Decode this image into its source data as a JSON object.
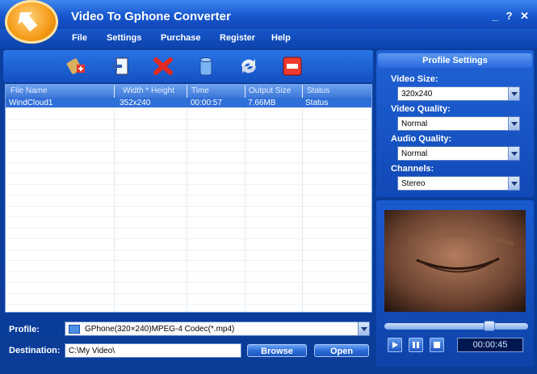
{
  "window": {
    "title": "Video To Gphone Converter",
    "controls": [
      "_",
      "?",
      "✕"
    ]
  },
  "menu": [
    "File",
    "Settings",
    "Purchase",
    "Register",
    "Help"
  ],
  "toolbar": {
    "tools": [
      {
        "name": "add-file-icon"
      },
      {
        "name": "add-folder-icon"
      },
      {
        "name": "remove-icon"
      },
      {
        "name": "clear-list-icon"
      },
      {
        "name": "convert-icon"
      },
      {
        "name": "stop-icon"
      }
    ]
  },
  "table": {
    "headers": [
      "File Name",
      "Width * Height",
      "Time",
      "Output Size",
      "Status"
    ],
    "rows": [
      {
        "file": "WindCloud1",
        "size": "352x240",
        "time": "00:00:57",
        "output": "7.66MB",
        "status": "Status"
      }
    ]
  },
  "profile": {
    "label": "Profile:",
    "value": "GPhone(320×240)MPEG-4 Codec(*.mp4)"
  },
  "destination": {
    "label": "Destination:",
    "value": "C:\\My Video\\",
    "browse": "Browse",
    "open": "Open"
  },
  "profile_settings": {
    "heading": "Profile Settings",
    "video_size_label": "Video Size:",
    "video_size": "320x240",
    "video_quality_label": "Video Quality:",
    "video_quality": "Normal",
    "audio_quality_label": "Audio Quality:",
    "audio_quality": "Normal",
    "channels_label": "Channels:",
    "channels": "Stereo"
  },
  "player": {
    "time": "00:00:45",
    "progress": 0.75
  }
}
